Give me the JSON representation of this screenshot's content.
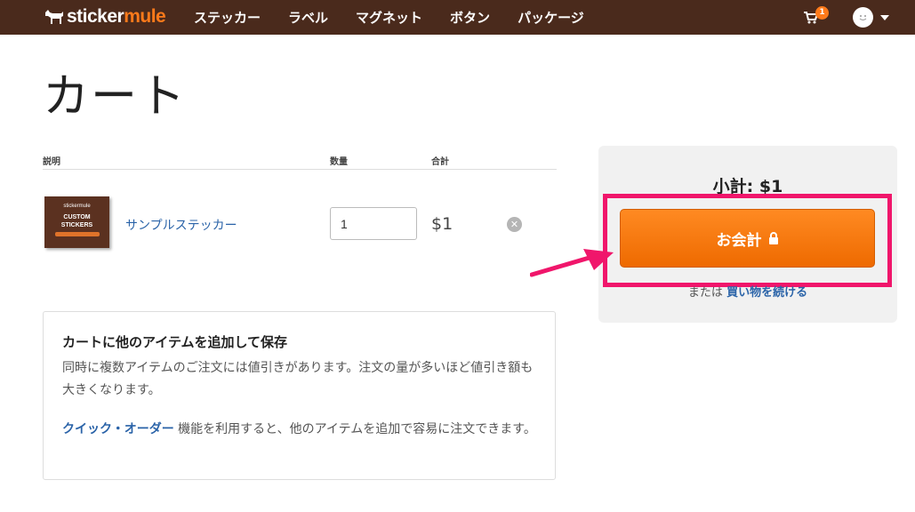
{
  "brand": {
    "name_a": "sticker",
    "name_b": "mule",
    "accent": "#ff7a1a",
    "nav_bg": "#4a2a1c"
  },
  "nav": {
    "items": [
      "ステッカー",
      "ラベル",
      "マグネット",
      "ボタン",
      "パッケージ"
    ]
  },
  "header": {
    "cart_count": "1"
  },
  "page": {
    "title": "カート"
  },
  "table": {
    "headers": {
      "description": "説明",
      "quantity": "数量",
      "total": "合計"
    },
    "rows": [
      {
        "thumb_brand": "stickermule",
        "thumb_text_1": "CUSTOM",
        "thumb_text_2": "STICKERS",
        "name": "サンプルステッカー",
        "quantity": "1",
        "total": "$1"
      }
    ]
  },
  "info": {
    "title": "カートに他のアイテムを追加して保存",
    "paragraph": "同時に複数アイテムのご注文には値引きがあります。注文の量が多いほど値引き額も大きくなります。",
    "quick_order_link": "クイック・オーダー",
    "quick_order_text": " 機能を利用すると、他のアイテムを追加で容易に注文できます。"
  },
  "summary": {
    "subtotal": "小計: $1",
    "checkout_label": "お会計",
    "or_text": "または ",
    "continue_link": "買い物を続ける",
    "highlight_color": "#f0166b"
  }
}
